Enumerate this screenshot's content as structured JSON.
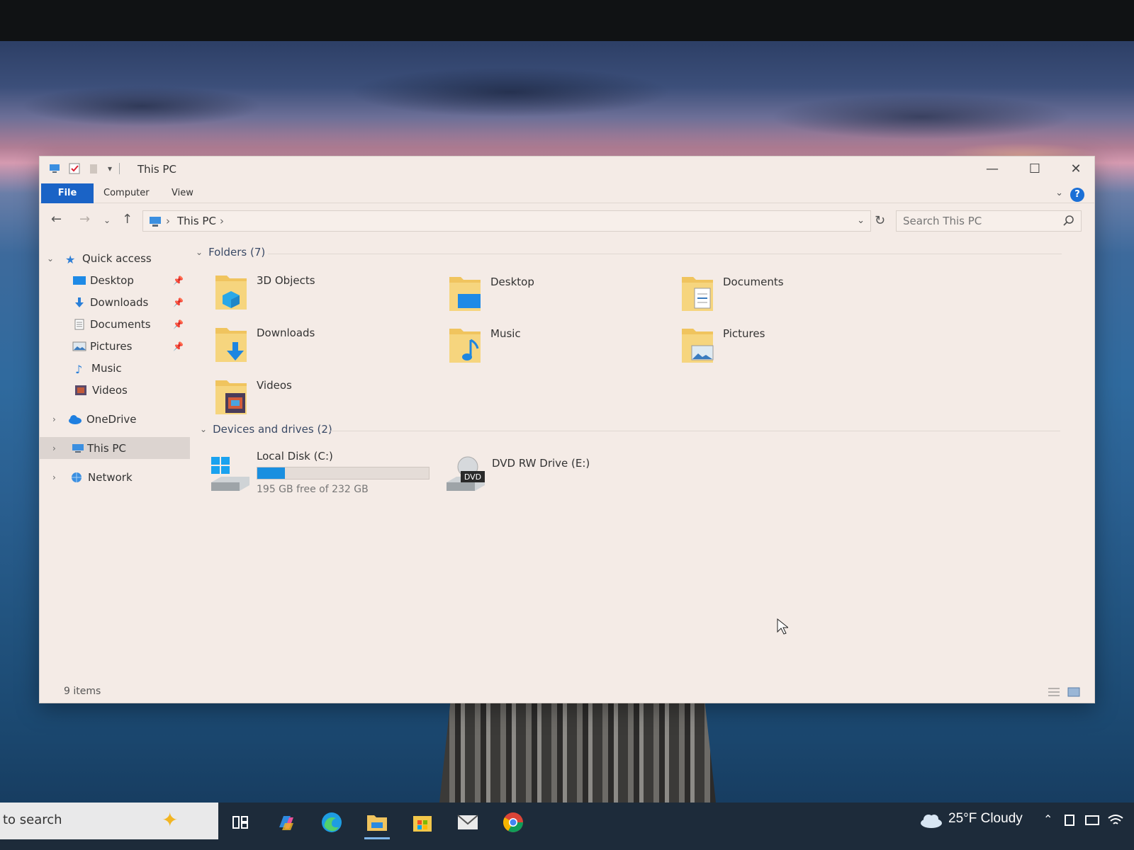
{
  "window": {
    "title": "This PC",
    "ribbon_tabs": {
      "file": "File",
      "computer": "Computer",
      "view": "View"
    },
    "help_label": "?"
  },
  "navigation": {
    "breadcrumb": [
      "This PC"
    ],
    "search_placeholder": "Search This PC"
  },
  "sidebar": {
    "quick_access": "Quick access",
    "pinned": [
      {
        "label": "Desktop",
        "icon": "desktop-icon"
      },
      {
        "label": "Downloads",
        "icon": "downloads-icon"
      },
      {
        "label": "Documents",
        "icon": "documents-icon"
      },
      {
        "label": "Pictures",
        "icon": "pictures-icon"
      },
      {
        "label": "Music",
        "icon": "music-icon"
      },
      {
        "label": "Videos",
        "icon": "videos-icon"
      }
    ],
    "onedrive": "OneDrive",
    "this_pc": "This PC",
    "network": "Network"
  },
  "content": {
    "folders_header": "Folders (7)",
    "folders": [
      {
        "label": "3D Objects",
        "icon": "3d-objects-icon"
      },
      {
        "label": "Desktop",
        "icon": "desktop-icon"
      },
      {
        "label": "Documents",
        "icon": "documents-icon"
      },
      {
        "label": "Downloads",
        "icon": "downloads-icon"
      },
      {
        "label": "Music",
        "icon": "music-icon"
      },
      {
        "label": "Pictures",
        "icon": "pictures-icon"
      },
      {
        "label": "Videos",
        "icon": "videos-icon"
      }
    ],
    "drives_header": "Devices and drives (2)",
    "drives": [
      {
        "label": "Local Disk (C:)",
        "free_text": "195 GB free of 232 GB",
        "used_fraction": 0.16
      },
      {
        "label": "DVD RW Drive (E:)",
        "badge": "DVD"
      }
    ]
  },
  "status": {
    "items": "9 items"
  },
  "taskbar": {
    "search_text": "to search",
    "weather": "25°F  Cloudy",
    "apps": [
      "task-view",
      "copilot",
      "edge",
      "file-explorer",
      "microsoft-store",
      "mail",
      "chrome"
    ]
  },
  "colors": {
    "accent": "#1a63c6",
    "folder": "#f0c45e",
    "drive_fill": "#1a8fe0",
    "window_bg": "#f4ebe6"
  }
}
